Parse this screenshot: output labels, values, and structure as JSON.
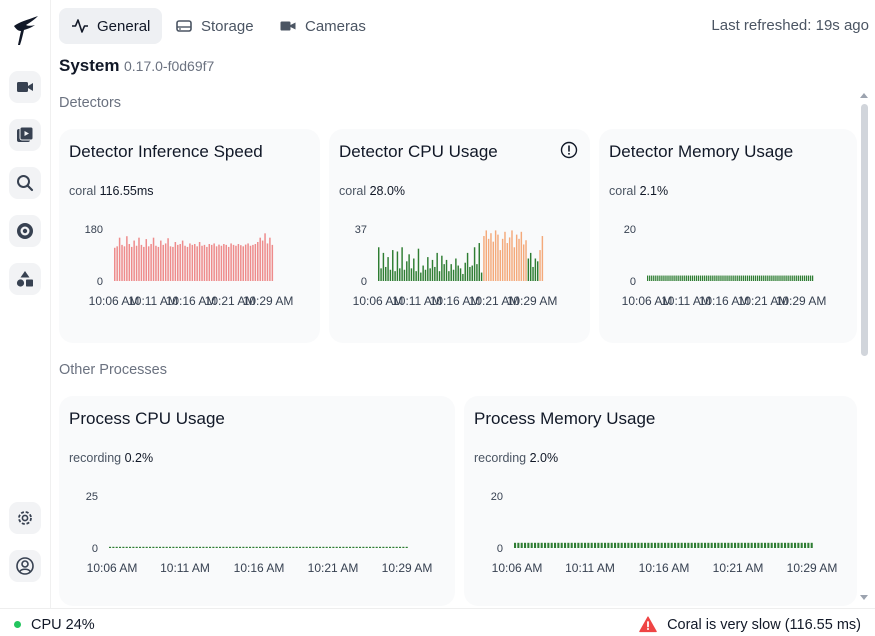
{
  "nav": {
    "tabs": [
      {
        "label": "General",
        "icon": "activity-icon",
        "active": true
      },
      {
        "label": "Storage",
        "icon": "hard-drive-icon",
        "active": false
      },
      {
        "label": "Cameras",
        "icon": "video-icon",
        "active": false
      }
    ],
    "last_refreshed": "Last refreshed: 19s ago"
  },
  "sidebar": {
    "items": [
      {
        "name": "live-view",
        "icon": "camera-icon"
      },
      {
        "name": "review",
        "icon": "play-library-icon"
      },
      {
        "name": "explore",
        "icon": "search-icon"
      },
      {
        "name": "export",
        "icon": "disc-icon"
      },
      {
        "name": "objects",
        "icon": "shapes-icon"
      }
    ],
    "bottom": [
      {
        "name": "settings",
        "icon": "gear-icon"
      },
      {
        "name": "account",
        "icon": "user-circle-icon"
      }
    ]
  },
  "system": {
    "title": "System",
    "version": "0.17.0-f0d69f7"
  },
  "sections": {
    "detectors": "Detectors",
    "other_processes": "Other Processes"
  },
  "cards": [
    {
      "title": "Detector Inference Speed",
      "stat_label": "coral",
      "stat_value": "116.55ms"
    },
    {
      "title": "Detector CPU Usage",
      "stat_label": "coral",
      "stat_value": "28.0%"
    },
    {
      "title": "Detector Memory Usage",
      "stat_label": "coral",
      "stat_value": "2.1%"
    },
    {
      "title": "Process CPU Usage",
      "stat_label": "recording",
      "stat_value": "0.2%"
    },
    {
      "title": "Process Memory Usage",
      "stat_label": "recording",
      "stat_value": "2.0%"
    }
  ],
  "statusbar": {
    "cpu": "CPU 24%",
    "warning": "Coral is very slow (116.55 ms)",
    "colors": {
      "ok": "#22c55e",
      "warn": "#ef4444"
    }
  },
  "chart_data": [
    {
      "type": "bar",
      "title": "Detector Inference Speed",
      "x_ticks": [
        "10:06 AM",
        "10:11 AM",
        "10:16 AM",
        "10:21 AM",
        "10:29 AM"
      ],
      "y_ticks": [
        0,
        180
      ],
      "ylim": [
        0,
        180
      ],
      "series": [
        {
          "color": "#ee8b8b",
          "values": [
            115,
            120,
            150,
            125,
            120,
            155,
            128,
            118,
            140,
            122,
            150,
            125,
            118,
            145,
            120,
            128,
            150,
            122,
            118,
            140,
            125,
            130,
            148,
            120,
            118,
            135,
            125,
            128,
            140,
            122,
            118,
            130,
            125,
            128,
            120,
            135,
            122,
            125,
            118,
            128,
            125,
            130,
            120,
            126,
            122,
            128,
            125,
            118,
            130,
            125,
            122,
            128,
            124,
            120,
            126,
            130,
            122,
            125,
            128,
            135,
            150,
            140,
            165,
            130,
            150,
            125
          ]
        }
      ]
    },
    {
      "type": "bar",
      "title": "Detector CPU Usage",
      "x_ticks": [
        "10:06 AM",
        "10:11 AM",
        "10:16 AM",
        "10:21 AM",
        "10:29 AM"
      ],
      "y_ticks": [
        0,
        37
      ],
      "ylim": [
        0,
        37
      ],
      "series": [
        {
          "color": "#2e7d32",
          "values": [
            24,
            9,
            20,
            10,
            17,
            8,
            22,
            7,
            21,
            9,
            24,
            8,
            14,
            19,
            9,
            16,
            7,
            23,
            6,
            11,
            8,
            17,
            9,
            15,
            10,
            20,
            7,
            18,
            12,
            15,
            7,
            12,
            8,
            16,
            11,
            9,
            5,
            13,
            20,
            10,
            11,
            24,
            12,
            27,
            6,
            0,
            0,
            0,
            0,
            0,
            0,
            0,
            0,
            0,
            0,
            0,
            0,
            0,
            0,
            0,
            0,
            0,
            0,
            0,
            16,
            20,
            10,
            16,
            14,
            0,
            0
          ]
        },
        {
          "color": "#f4a97a",
          "values": [
            0,
            0,
            0,
            0,
            0,
            0,
            0,
            0,
            0,
            0,
            0,
            0,
            0,
            0,
            0,
            0,
            0,
            0,
            0,
            0,
            0,
            0,
            0,
            0,
            0,
            0,
            0,
            0,
            0,
            0,
            0,
            0,
            0,
            0,
            0,
            0,
            0,
            0,
            0,
            0,
            0,
            0,
            0,
            0,
            0,
            32,
            36,
            30,
            34,
            28,
            36,
            33,
            22,
            30,
            35,
            27,
            31,
            36,
            24,
            33,
            30,
            35,
            26,
            29,
            0,
            0,
            0,
            0,
            0,
            22,
            32
          ]
        }
      ]
    },
    {
      "type": "bar",
      "title": "Detector Memory Usage",
      "x_ticks": [
        "10:06 AM",
        "10:11 AM",
        "10:16 AM",
        "10:21 AM",
        "10:29 AM"
      ],
      "y_ticks": [
        0,
        20
      ],
      "ylim": [
        0,
        20
      ],
      "series": [
        {
          "color": "#2e7d32",
          "values": [
            2.1,
            2.1,
            2.1,
            2.1,
            2.1,
            2.1,
            2.1,
            2.1,
            2.1,
            2.1,
            2.1,
            2.1,
            2.1,
            2.1,
            2.1,
            2.1,
            2.1,
            2.1,
            2.1,
            2.1,
            2.1,
            2.1,
            2.1,
            2.1,
            2.1,
            2.1,
            2.1,
            2.1,
            2.1,
            2.1,
            2.1,
            2.1,
            2.1,
            2.1,
            2.1,
            2.1,
            2.1,
            2.1,
            2.1,
            2.1,
            2.1,
            2.1,
            2.1,
            2.1,
            2.1,
            2.1,
            2.1,
            2.1,
            2.1,
            2.1,
            2.1,
            2.1,
            2.1,
            2.1,
            2.1,
            2.1,
            2.1,
            2.1,
            2.1,
            2.1,
            2.1,
            2.1,
            2.1,
            2.1,
            2.1,
            2.1,
            2.1,
            2.1,
            2.1,
            2.1,
            2.1,
            2.1,
            2.1,
            2.1,
            2.1,
            2.1,
            2.1,
            2.1,
            2.1,
            2.1,
            2.1,
            2.1
          ]
        }
      ]
    },
    {
      "type": "bar",
      "title": "Process CPU Usage",
      "x_ticks": [
        "10:06 AM",
        "10:11 AM",
        "10:16 AM",
        "10:21 AM",
        "10:29 AM"
      ],
      "y_ticks": [
        0,
        25
      ],
      "ylim": [
        0,
        25
      ],
      "series": [
        {
          "color": "#2e7d32",
          "values": [
            0.2,
            0.2,
            0.2,
            0.2,
            0.2,
            0.2,
            0.2,
            0.2,
            0.2,
            0.2,
            0.2,
            0.2,
            0.2,
            0.2,
            0.2,
            0.2,
            0.2,
            0.2,
            0.2,
            0.2,
            0.2,
            0.2,
            0.2,
            0.2,
            0.2,
            0.2,
            0.2,
            0.2,
            0.2,
            0.2,
            0.2,
            0.2,
            0.2,
            0.2,
            0.2,
            0.2,
            0.2,
            0.2,
            0.2,
            0.2,
            0.2,
            0.2,
            0.2,
            0.2,
            0.2,
            0.2,
            0.2,
            0.2,
            0.2,
            0.2,
            0.2,
            0.2,
            0.2,
            0.2,
            0.2,
            0.2,
            0.2,
            0.2,
            0.2,
            0.2,
            0.2,
            0.2,
            0.2,
            0.2,
            0.2,
            0.2,
            0.2,
            0.2,
            0.2,
            0.2,
            0.2,
            0.2,
            0.2,
            0.2,
            0.2,
            0.2,
            0.2,
            0.2,
            0.2,
            0.2,
            0.2,
            0.2,
            0.2,
            0.2,
            0.2,
            0.2,
            0.2,
            0.2,
            0.2,
            0.2
          ]
        }
      ]
    },
    {
      "type": "bar",
      "title": "Process Memory Usage",
      "x_ticks": [
        "10:06 AM",
        "10:11 AM",
        "10:16 AM",
        "10:21 AM",
        "10:29 AM"
      ],
      "y_ticks": [
        0,
        20
      ],
      "ylim": [
        0,
        20
      ],
      "series": [
        {
          "color": "#2e7d32",
          "values": [
            2.0,
            2.0,
            2.0,
            2.0,
            2.0,
            2.0,
            2.0,
            2.0,
            2.0,
            2.0,
            2.0,
            2.0,
            2.0,
            2.0,
            2.0,
            2.0,
            2.0,
            2.0,
            2.0,
            2.0,
            2.0,
            2.0,
            2.0,
            2.0,
            2.0,
            2.0,
            2.0,
            2.0,
            2.0,
            2.0,
            2.0,
            2.0,
            2.0,
            2.0,
            2.0,
            2.0,
            2.0,
            2.0,
            2.0,
            2.0,
            2.0,
            2.0,
            2.0,
            2.0,
            2.0,
            2.0,
            2.0,
            2.0,
            2.0,
            2.0,
            2.0,
            2.0,
            2.0,
            2.0,
            2.0,
            2.0,
            2.0,
            2.0,
            2.0,
            2.0,
            2.0,
            2.0,
            2.0,
            2.0,
            2.0,
            2.0,
            2.0,
            2.0,
            2.0,
            2.0,
            2.0,
            2.0,
            2.0,
            2.0,
            2.0,
            2.0,
            2.0,
            2.0,
            2.0,
            2.0,
            2.0,
            2.0,
            2.0,
            2.0,
            2.0,
            2.0,
            2.0,
            2.0,
            2.0,
            2.0
          ]
        }
      ]
    }
  ]
}
